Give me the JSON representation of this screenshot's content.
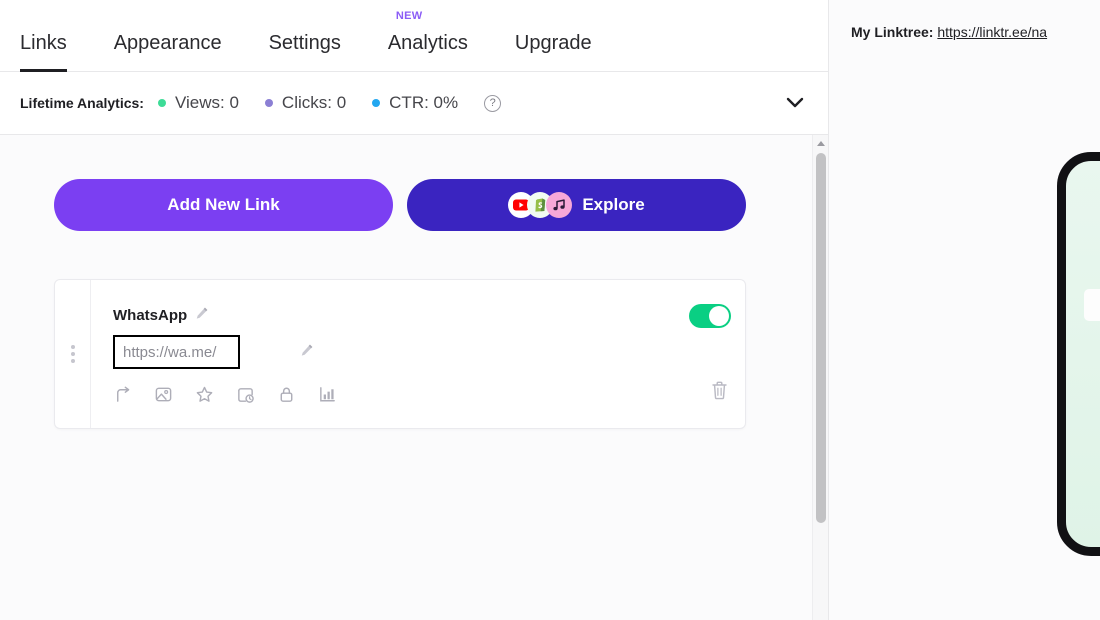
{
  "nav": {
    "tabs": [
      {
        "label": "Links",
        "active": true,
        "badge": ""
      },
      {
        "label": "Appearance",
        "active": false,
        "badge": ""
      },
      {
        "label": "Settings",
        "active": false,
        "badge": ""
      },
      {
        "label": "Analytics",
        "active": false,
        "badge": "NEW"
      },
      {
        "label": "Upgrade",
        "active": false,
        "badge": ""
      }
    ]
  },
  "analytics": {
    "label": "Lifetime Analytics:",
    "stats": [
      {
        "text": "Views: 0",
        "color": "#3DDC97",
        "name": "views"
      },
      {
        "text": "Clicks: 0",
        "color": "#8B7FD4",
        "name": "clicks"
      },
      {
        "text": "CTR: 0%",
        "color": "#22A7F0",
        "name": "ctr"
      }
    ],
    "help_icon": "?",
    "collapse_icon": "⌄"
  },
  "actions": {
    "add_new_link": "Add New Link",
    "explore": "Explore",
    "explore_icons": [
      "youtube-icon",
      "shopify-icon",
      "music-note-icon"
    ]
  },
  "link_card": {
    "title": "WhatsApp",
    "url_value": "https://wa.me/",
    "url_placeholder": "https://wa.me/",
    "toggle_state": "on",
    "toggle_color": "#0ACF83",
    "action_icons": [
      "redirect-arrow-icon",
      "image-icon",
      "star-icon",
      "schedule-clock-icon",
      "lock-icon",
      "bar-chart-icon"
    ],
    "delete_icon": "trash-icon",
    "drag_handle": "drag-dots-handle",
    "edit_icon": "pencil-icon"
  },
  "preview": {
    "linktree_label": "My Linktree:",
    "linktree_url": "https://linktr.ee/na"
  }
}
